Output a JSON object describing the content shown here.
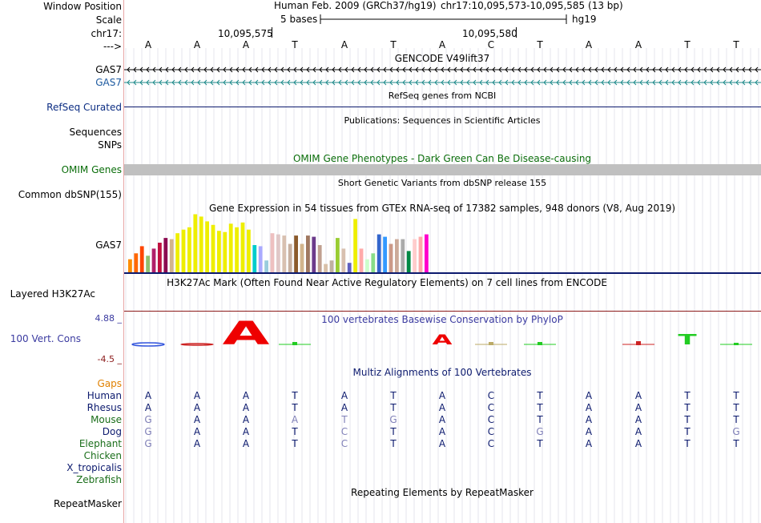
{
  "header": {
    "window_position_label": "Window Position",
    "scale_label": "Scale",
    "chrom_label": "chr17:",
    "arrow_label": "--->",
    "assembly": "Human Feb. 2009 (GRCh37/hg19)",
    "position": "chr17:10,095,573-10,095,585 (13 bp)",
    "scale_text": "5 bases",
    "db": "hg19",
    "coord_ticks": [
      "10,095,575",
      "10,095,580"
    ]
  },
  "sequence": [
    "A",
    "A",
    "A",
    "T",
    "A",
    "T",
    "A",
    "C",
    "T",
    "A",
    "A",
    "T",
    "T"
  ],
  "tracks": {
    "gencode_title": "GENCODE V49lift37",
    "gencode_label_1": "GAS7",
    "gencode_label_2": "GAS7",
    "refseq_label": "RefSeq Curated",
    "refseq_title": "RefSeq genes from NCBI",
    "pubs_title": "Publications: Sequences in Scientific Articles",
    "pubs_label": "Sequences",
    "snps_label": "SNPs",
    "omim_title": "OMIM Gene Phenotypes - Dark Green Can Be Disease-causing",
    "omim_label": "OMIM Genes",
    "dbsnp_title": "Short Genetic Variants from dbSNP release 155",
    "dbsnp_label": "Common dbSNP(155)",
    "gtex_title": "Gene Expression in 54 tissues from GTEx RNA-seq of 17382 samples, 948 donors (V8, Aug 2019)",
    "gtex_label": "GAS7",
    "h3k27_title": "H3K27Ac Mark (Often Found Near Active Regulatory Elements) on 7 cell lines from ENCODE",
    "h3k27_label": "Layered H3K27Ac",
    "cons_title": "100 vertebrates Basewise Conservation by PhyloP",
    "cons_max": "4.88 _",
    "cons_label": "100 Vert. Cons",
    "cons_min": "-4.5 _",
    "multiz_title": "Multiz Alignments of 100 Vertebrates",
    "gaps_label": "Gaps",
    "repeat_title": "Repeating Elements by RepeatMasker",
    "repeat_label": "RepeatMasker"
  },
  "gtex_bars": [
    {
      "value": 0.22,
      "color": "#ff8c00"
    },
    {
      "value": 0.32,
      "color": "#ff6600"
    },
    {
      "value": 0.44,
      "color": "#ff4500"
    },
    {
      "value": 0.28,
      "color": "#90c070"
    },
    {
      "value": 0.4,
      "color": "#b0206a"
    },
    {
      "value": 0.5,
      "color": "#c01040"
    },
    {
      "value": 0.58,
      "color": "#8b0a50"
    },
    {
      "value": 0.56,
      "color": "#d2b48c"
    },
    {
      "value": 0.66,
      "color": "#eeee00"
    },
    {
      "value": 0.72,
      "color": "#eeee00"
    },
    {
      "value": 0.76,
      "color": "#eeee00"
    },
    {
      "value": 0.98,
      "color": "#eeee00"
    },
    {
      "value": 0.94,
      "color": "#eeee00"
    },
    {
      "value": 0.86,
      "color": "#eeee00"
    },
    {
      "value": 0.8,
      "color": "#eeee00"
    },
    {
      "value": 0.7,
      "color": "#eeee00"
    },
    {
      "value": 0.68,
      "color": "#eeee00"
    },
    {
      "value": 0.82,
      "color": "#eeee00"
    },
    {
      "value": 0.76,
      "color": "#eeee00"
    },
    {
      "value": 0.84,
      "color": "#eeee00"
    },
    {
      "value": 0.72,
      "color": "#eeee00"
    },
    {
      "value": 0.46,
      "color": "#00cccc"
    },
    {
      "value": 0.44,
      "color": "#aaaaff"
    },
    {
      "value": 0.2,
      "color": "#99ccdd"
    },
    {
      "value": 0.66,
      "color": "#eec0c0"
    },
    {
      "value": 0.64,
      "color": "#e0c8c8"
    },
    {
      "value": 0.62,
      "color": "#d8c0b0"
    },
    {
      "value": 0.48,
      "color": "#c8b0a0"
    },
    {
      "value": 0.62,
      "color": "#8b5a2b"
    },
    {
      "value": 0.48,
      "color": "#d2b48c"
    },
    {
      "value": 0.62,
      "color": "#a07860"
    },
    {
      "value": 0.6,
      "color": "#6b3a8b"
    },
    {
      "value": 0.46,
      "color": "#c0a090"
    },
    {
      "value": 0.14,
      "color": "#d8c0a8"
    },
    {
      "value": 0.2,
      "color": "#c0b0a0"
    },
    {
      "value": 0.58,
      "color": "#99cc33"
    },
    {
      "value": 0.4,
      "color": "#d8c0b0"
    },
    {
      "value": 0.16,
      "color": "#6060c0"
    },
    {
      "value": 0.9,
      "color": "#eeee00"
    },
    {
      "value": 0.4,
      "color": "#ffaaaa"
    },
    {
      "value": 0.22,
      "color": "#ccffcc"
    },
    {
      "value": 0.32,
      "color": "#88dd88"
    },
    {
      "value": 0.64,
      "color": "#3366cc"
    },
    {
      "value": 0.6,
      "color": "#3399ff"
    },
    {
      "value": 0.48,
      "color": "#cc9988"
    },
    {
      "value": 0.56,
      "color": "#ccaa99"
    },
    {
      "value": 0.56,
      "color": "#aaaaaa"
    },
    {
      "value": 0.36,
      "color": "#008844"
    },
    {
      "value": 0.56,
      "color": "#ffcccc"
    },
    {
      "value": 0.6,
      "color": "#ffaaaa"
    },
    {
      "value": 0.64,
      "color": "#ff00cc"
    }
  ],
  "conservation": [
    {
      "value": -0.4,
      "color": "#3355dd",
      "glyph": "A"
    },
    {
      "value": -0.15,
      "color": "#cc2222",
      "glyph": "A"
    },
    {
      "value": 2.4,
      "color": "#ee0000",
      "glyph": "A"
    },
    {
      "value": 0.3,
      "color": "#22cc22",
      "glyph": "T"
    },
    {
      "value": 0,
      "color": "#aaaaaa",
      "glyph": ""
    },
    {
      "value": 0,
      "color": "#aaaaaa",
      "glyph": ""
    },
    {
      "value": 1.0,
      "color": "#ee0000",
      "glyph": "A"
    },
    {
      "value": 0.3,
      "color": "#bbaa66",
      "glyph": "C"
    },
    {
      "value": 0.3,
      "color": "#22cc22",
      "glyph": "T"
    },
    {
      "value": 0,
      "color": "#aaaaaa",
      "glyph": ""
    },
    {
      "value": 0.4,
      "color": "#cc2222",
      "glyph": "A"
    },
    {
      "value": 1.1,
      "color": "#22cc22",
      "glyph": "T"
    },
    {
      "value": 0.2,
      "color": "#22cc22",
      "glyph": "T"
    }
  ],
  "species": [
    {
      "name": "Human",
      "color": "#0c1a6e",
      "seq": [
        "A",
        "A",
        "A",
        "T",
        "A",
        "T",
        "A",
        "C",
        "T",
        "A",
        "A",
        "T",
        "T"
      ],
      "faint": []
    },
    {
      "name": "Rhesus",
      "color": "#0c1a6e",
      "seq": [
        "A",
        "A",
        "A",
        "T",
        "A",
        "T",
        "A",
        "C",
        "T",
        "A",
        "A",
        "T",
        "T"
      ],
      "faint": []
    },
    {
      "name": "Mouse",
      "color": "#1a6e1a",
      "seq": [
        "G",
        "A",
        "A",
        "A",
        "T",
        "G",
        "A",
        "C",
        "T",
        "A",
        "A",
        "T",
        "T"
      ],
      "faint": [
        0,
        3,
        4,
        5
      ]
    },
    {
      "name": "Dog",
      "color": "#0c1a6e",
      "seq": [
        "G",
        "A",
        "A",
        "T",
        "C",
        "T",
        "A",
        "C",
        "G",
        "A",
        "A",
        "T",
        "G"
      ],
      "faint": [
        0,
        4,
        8,
        12
      ]
    },
    {
      "name": "Elephant",
      "color": "#1a6e1a",
      "seq": [
        "G",
        "A",
        "A",
        "T",
        "C",
        "T",
        "A",
        "C",
        "T",
        "A",
        "A",
        "T",
        "T"
      ],
      "faint": [
        0,
        4
      ]
    },
    {
      "name": "Chicken",
      "color": "#1a6e1a",
      "seq": [],
      "faint": []
    },
    {
      "name": "X_tropicalis",
      "color": "#0c1a6e",
      "seq": [],
      "faint": []
    },
    {
      "name": "Zebrafish",
      "color": "#1a6e1a",
      "seq": [],
      "faint": []
    }
  ],
  "colors": {
    "gencode_1": "#000000",
    "gencode_2": "#1d8a8a",
    "refseq": "#0c1a6e",
    "omim_bar": "#c0c0c0",
    "omim_title": "#0b6e0b",
    "cons_title": "#3a3aa0",
    "gaps_label": "#e08000",
    "h3k27_line": "#8b1a1a"
  }
}
